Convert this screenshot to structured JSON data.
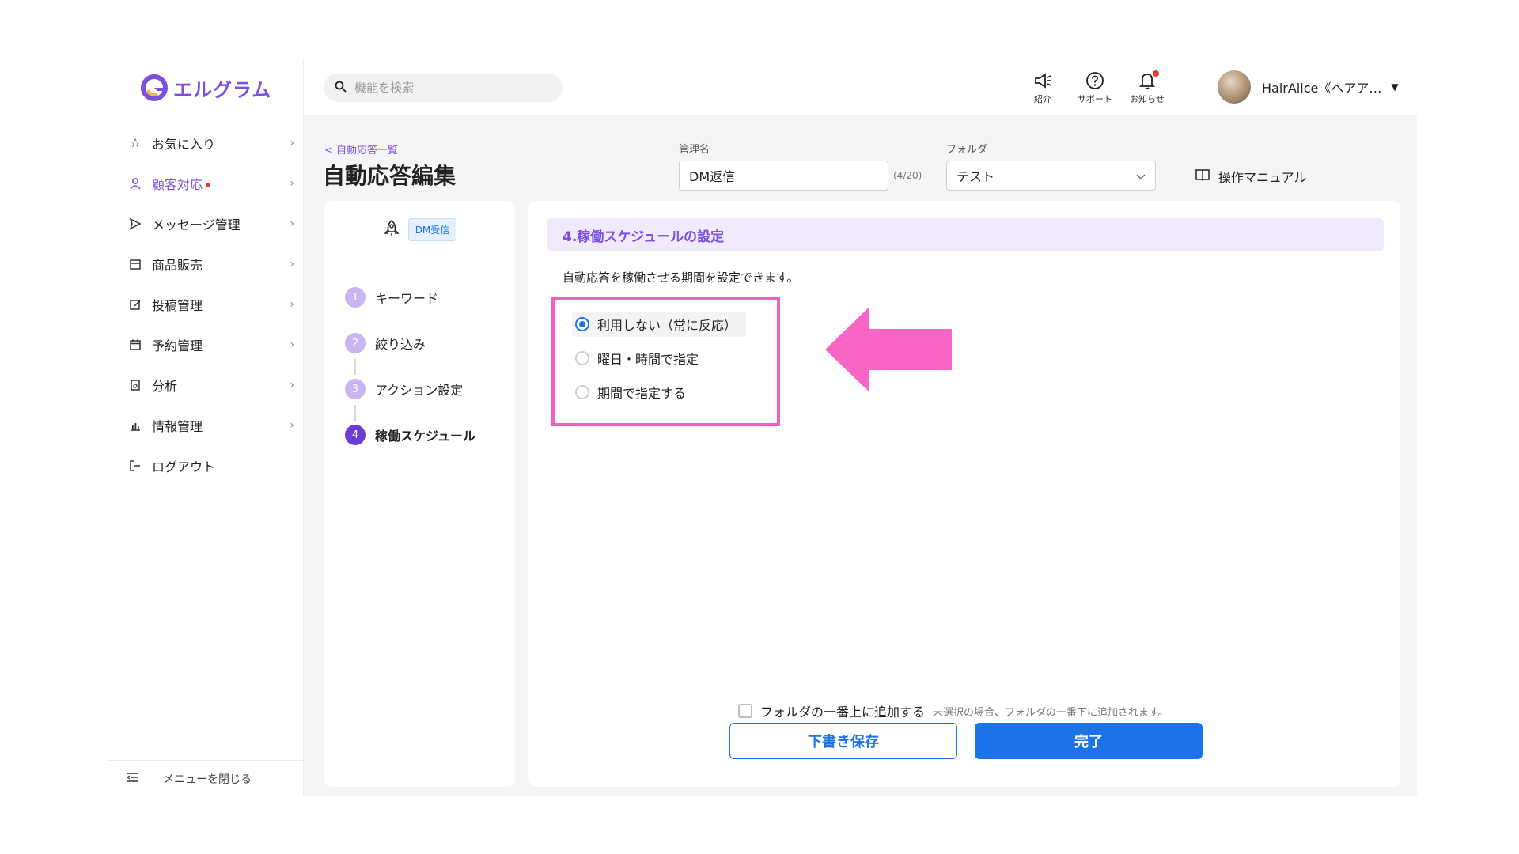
{
  "brand": {
    "name": "エルグラム",
    "color": "#7b4fe0"
  },
  "sidebar": {
    "items": [
      {
        "label": "お気に入り",
        "icon": "star-icon"
      },
      {
        "label": "顧客対応",
        "icon": "person-icon",
        "active": true,
        "alert_dot": true
      },
      {
        "label": "メッセージ管理",
        "icon": "send-icon"
      },
      {
        "label": "商品販売",
        "icon": "shop-icon"
      },
      {
        "label": "投稿管理",
        "icon": "edit-icon"
      },
      {
        "label": "予約管理",
        "icon": "calendar-icon"
      },
      {
        "label": "分析",
        "icon": "report-icon"
      },
      {
        "label": "情報管理",
        "icon": "bar-chart-icon"
      },
      {
        "label": "ログアウト",
        "icon": "logout-icon"
      }
    ],
    "close_menu_label": "メニューを閉じる"
  },
  "topbar": {
    "search_placeholder": "機能を検索",
    "icons": [
      {
        "label": "紹介",
        "icon": "megaphone-icon"
      },
      {
        "label": "サポート",
        "icon": "help-icon"
      },
      {
        "label": "お知らせ",
        "icon": "bell-icon",
        "alert_dot": true
      }
    ],
    "user_name": "HairAlice《ヘアア…"
  },
  "header": {
    "back_link": "< 自動応答一覧",
    "title": "自動応答編集",
    "name_label": "管理名",
    "name_value": "DM返信",
    "name_count": "(4/20)",
    "folder_label": "フォルダ",
    "folder_value": "テスト",
    "manual_label": "操作マニュアル"
  },
  "steps": {
    "trigger_badge": "DM受信",
    "items": [
      {
        "num": "1",
        "label": "キーワード"
      },
      {
        "num": "2",
        "label": "絞り込み"
      },
      {
        "num": "3",
        "label": "アクション設定"
      },
      {
        "num": "4",
        "label": "稼働スケジュール",
        "current": true
      }
    ]
  },
  "main": {
    "section_title": "4.稼働スケジュールの設定",
    "description": "自動応答を稼働させる期間を設定できます。",
    "options": [
      {
        "label": "利用しない（常に反応）",
        "selected": true
      },
      {
        "label": "曜日・時間で指定",
        "selected": false
      },
      {
        "label": "期間で指定する",
        "selected": false
      }
    ],
    "highlight_color": "#f15fc2",
    "arrow_color": "#f766c5"
  },
  "footer": {
    "add_top_label": "フォルダの一番上に追加する",
    "add_top_note": "未選択の場合、フォルダの一番下に追加されます。",
    "draft_label": "下書き保存",
    "done_label": "完了",
    "accent": "#1a73e8"
  }
}
